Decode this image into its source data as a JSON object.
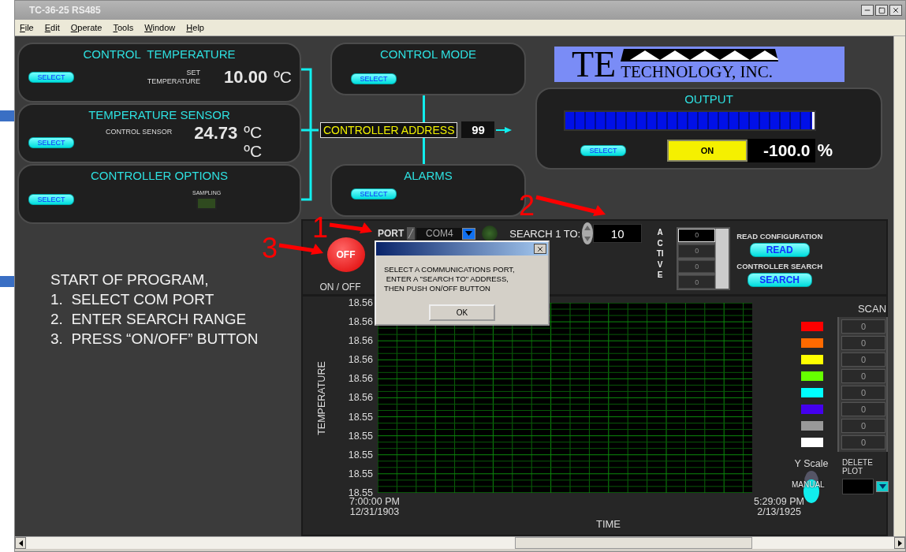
{
  "window": {
    "title": "TC-36-25 RS485"
  },
  "menu": [
    "File",
    "Edit",
    "Operate",
    "Tools",
    "Window",
    "Help"
  ],
  "control_temperature": {
    "title": "CONTROL  TEMPERATURE",
    "button": "SELECT",
    "label_lines": [
      "SET",
      "TEMPERATURE"
    ],
    "value": "10.00",
    "unit": "ºC"
  },
  "temperature_sensor": {
    "title": "TEMPERATURE SENSOR",
    "button": "SELECT",
    "label": "CONTROL SENSOR",
    "value": "24.73",
    "units": [
      "ºC",
      "ºC"
    ]
  },
  "controller_options": {
    "title": "CONTROLLER OPTIONS",
    "button": "SELECT",
    "indicator": {
      "label": "SAMPLING",
      "on": false
    }
  },
  "control_mode": {
    "title": "CONTROL MODE",
    "button": "SELECT"
  },
  "controller_address": {
    "label": "CONTROLLER ADDRESS",
    "value": "99"
  },
  "alarms": {
    "title": "ALARMS",
    "button": "SELECT"
  },
  "logo": {
    "mark": "TE",
    "name": "TECHNOLOGY, INC."
  },
  "output": {
    "title": "OUTPUT",
    "level": 1,
    "button": "SELECT",
    "switch": {
      "label": "ON",
      "on": true
    },
    "value": "-100.0",
    "unit": "%"
  },
  "instructions": [
    "START OF PROGRAM,",
    "1.  SELECT COM PORT",
    "2.  ENTER SEARCH RANGE",
    "3.  PRESS “ON/OFF” BUTTON"
  ],
  "power": {
    "button": "OFF",
    "on": false,
    "label": "ON / OFF"
  },
  "port": {
    "label": "PORT",
    "value": "COM4",
    "led_on": false
  },
  "search": {
    "label": "SEARCH 1 TO:",
    "value": "10"
  },
  "active": {
    "label": "ACTIVE",
    "items": [
      {
        "value": "0",
        "selected": true
      },
      {
        "value": "0",
        "selected": false
      },
      {
        "value": "0",
        "selected": false
      },
      {
        "value": "0",
        "selected": false
      }
    ]
  },
  "read": {
    "label": "READ CONFIGURATION",
    "button": "READ"
  },
  "controller_search": {
    "label": "CONTROLLER SEARCH",
    "button": "SEARCH"
  },
  "chart": {
    "ylabel": "TEMPERATURE",
    "xlabel": "TIME",
    "y_tick_labels": [
      "18.56",
      "18.56",
      "18.56",
      "18.56",
      "18.56",
      "18.56",
      "18.55",
      "18.55",
      "18.55",
      "18.55",
      "18.55"
    ],
    "x_start": [
      "7:00:00 PM",
      "12/31/1903"
    ],
    "x_end": [
      "5:29:09 PM",
      "2/13/1925"
    ]
  },
  "scan": {
    "title": "SCAN",
    "items": [
      {
        "color": "#ff0000",
        "value": "0"
      },
      {
        "color": "#ff6a00",
        "value": "0"
      },
      {
        "color": "#ffff00",
        "value": "0"
      },
      {
        "color": "#66ff00",
        "value": "0"
      },
      {
        "color": "#00ffff",
        "value": "0"
      },
      {
        "color": "#4400ee",
        "value": "0"
      },
      {
        "color": "#999999",
        "value": "0"
      },
      {
        "color": "#ffffff",
        "value": "0"
      }
    ]
  },
  "y_scale": {
    "label": "Y Scale",
    "mode": "MANUAL",
    "manual": true
  },
  "delete_plot": {
    "label": "DELETE PLOT"
  },
  "dialog": {
    "message_lines": [
      "SELECT A COMMUNICATIONS PORT,",
      " ENTER A \"SEARCH TO\" ADDRESS,",
      "THEN PUSH ON/OFF BUTTON"
    ],
    "button": "OK"
  },
  "annotations": [
    "1",
    "2",
    "3"
  ]
}
